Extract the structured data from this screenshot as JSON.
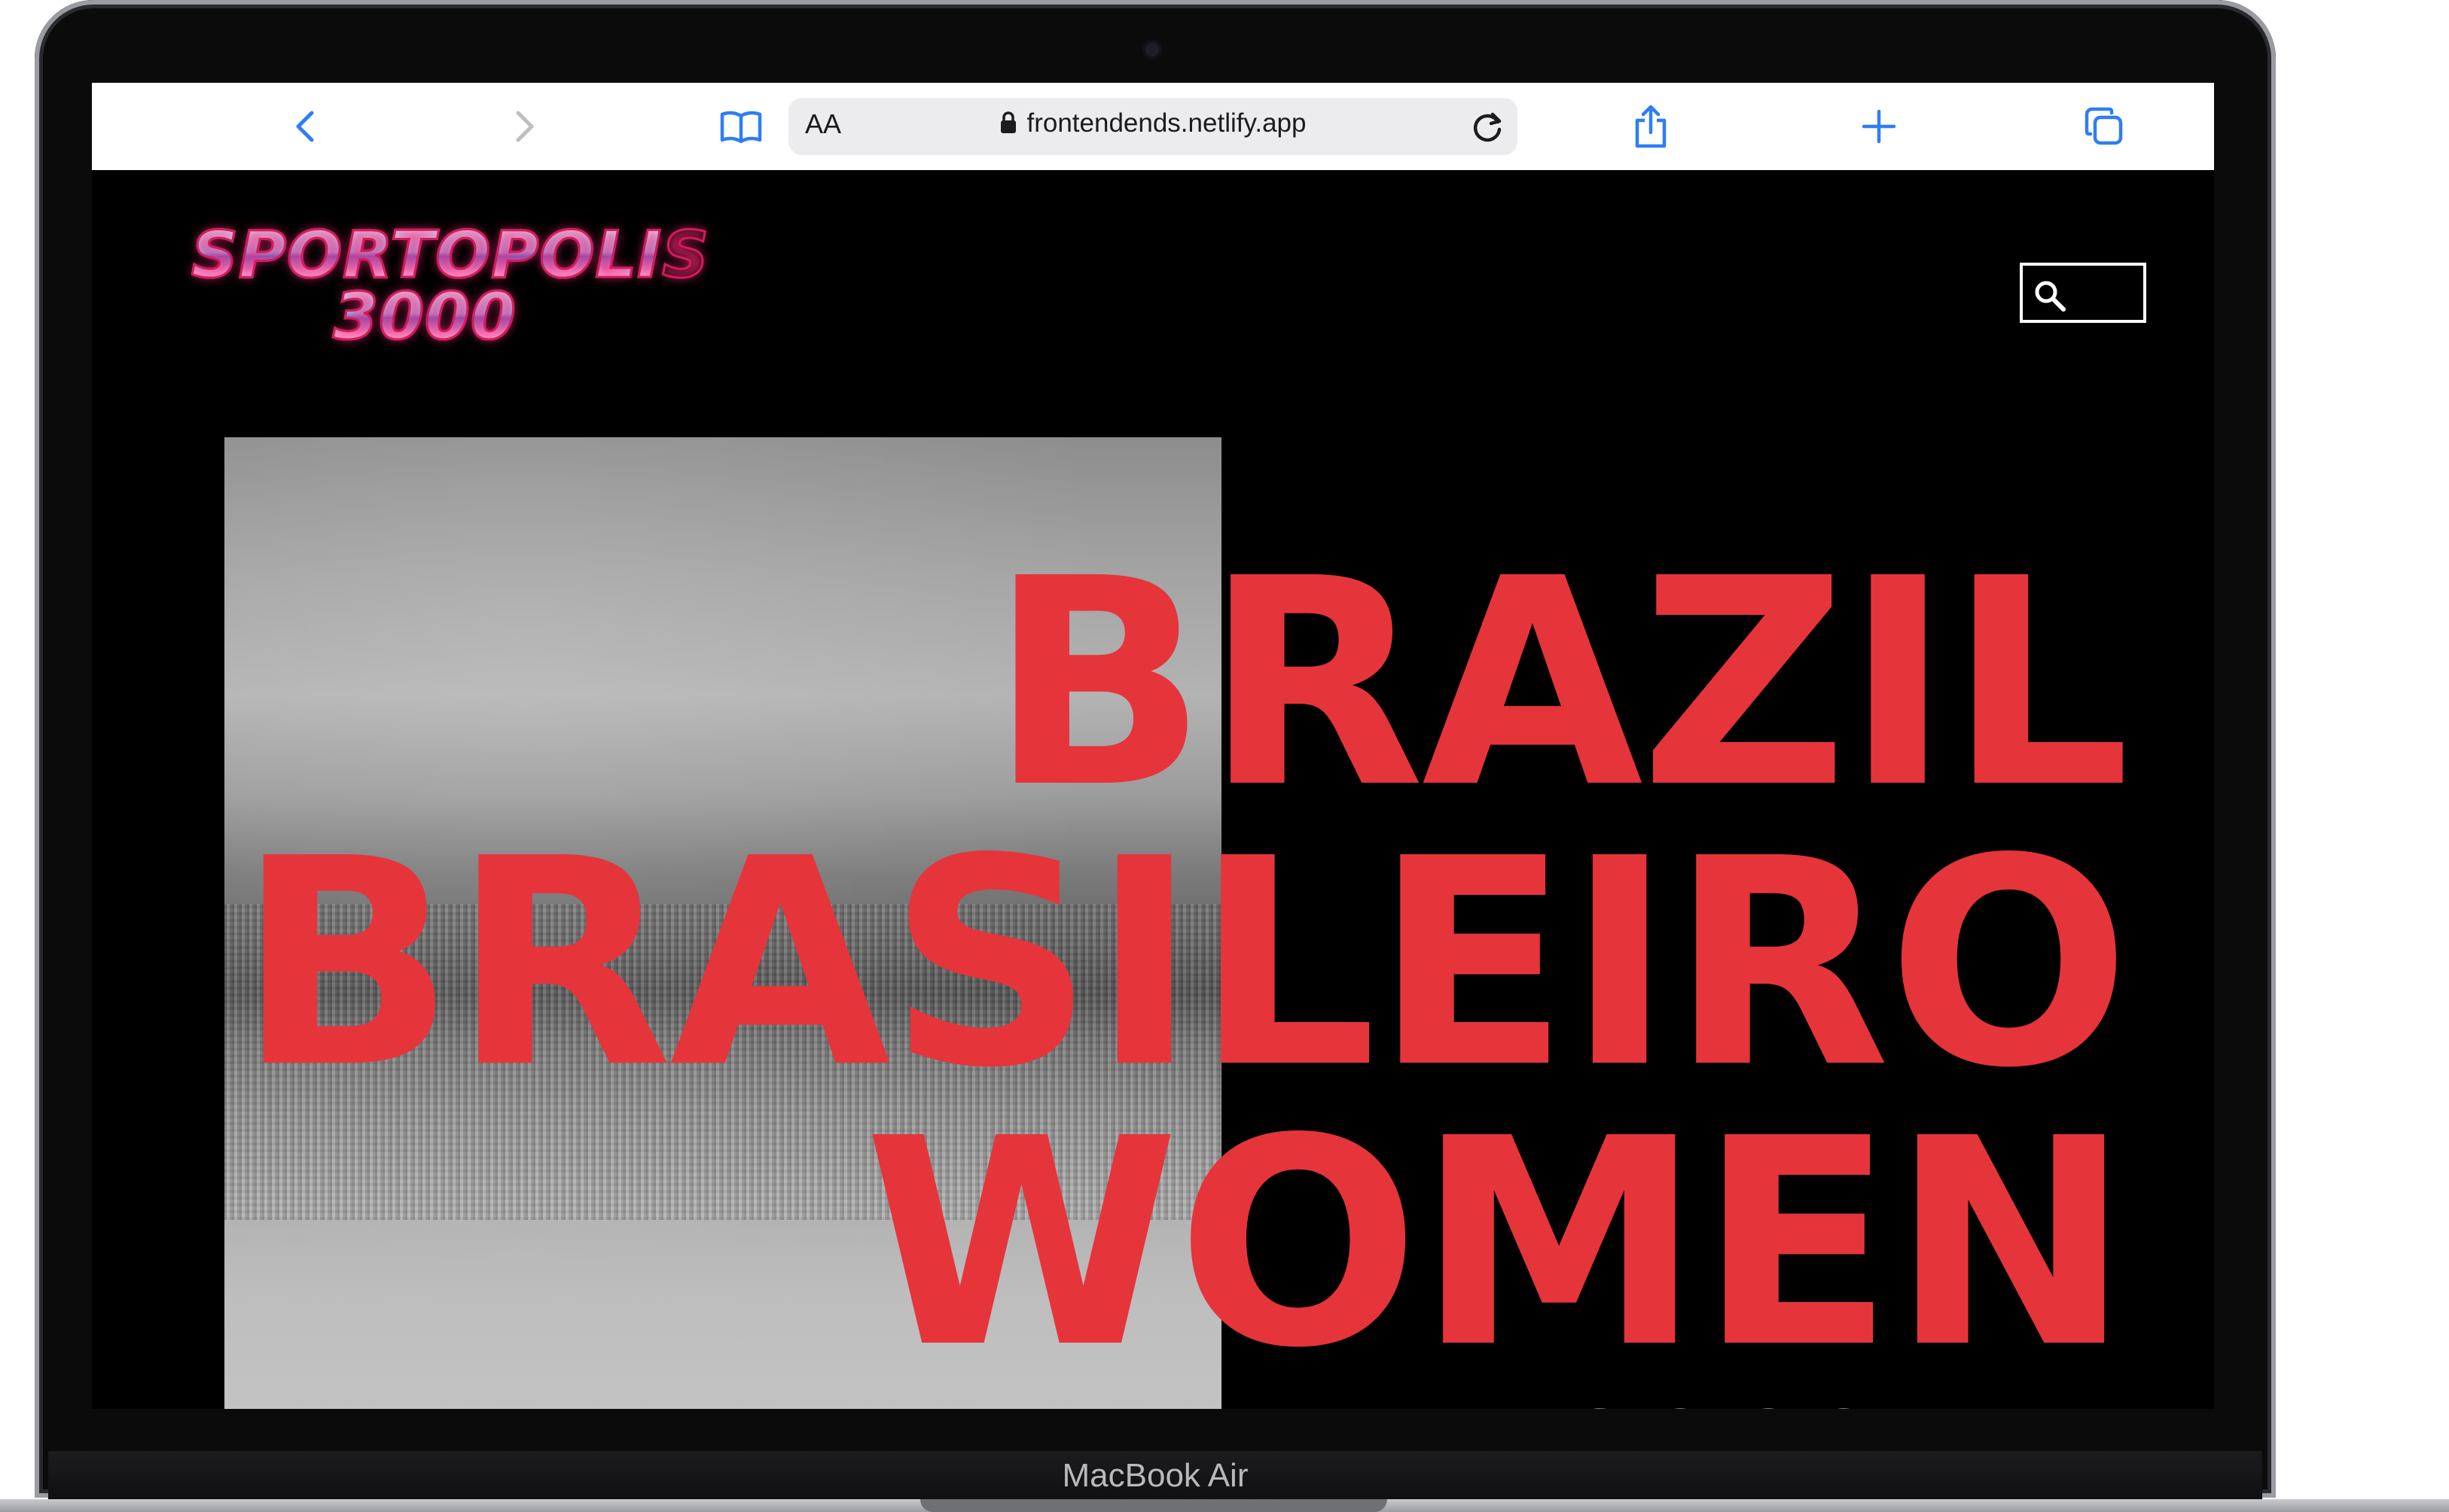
{
  "browser": {
    "text_size_label": "AA",
    "url": "frontendends.netlify.app"
  },
  "site": {
    "logo_line1": "SPORTOPOLIS",
    "logo_line2": "3000"
  },
  "hero": {
    "line1": "BRAZIL",
    "line2": "BRASILEIRO",
    "line3": "WOMEN",
    "line4": "SOCCER"
  },
  "device": {
    "model": "MacBook Air"
  },
  "colors": {
    "headline": "#e6343b",
    "toolbar_icons": "#2f7df6",
    "page_bg": "#000000"
  },
  "icons": {
    "back": "chevron-left-icon",
    "forward": "chevron-right-icon",
    "bookmarks": "book-icon",
    "lock": "lock-icon",
    "reload": "reload-icon",
    "share": "share-icon",
    "new_tab": "plus-icon",
    "tabs": "tabs-icon",
    "search": "search-icon"
  }
}
